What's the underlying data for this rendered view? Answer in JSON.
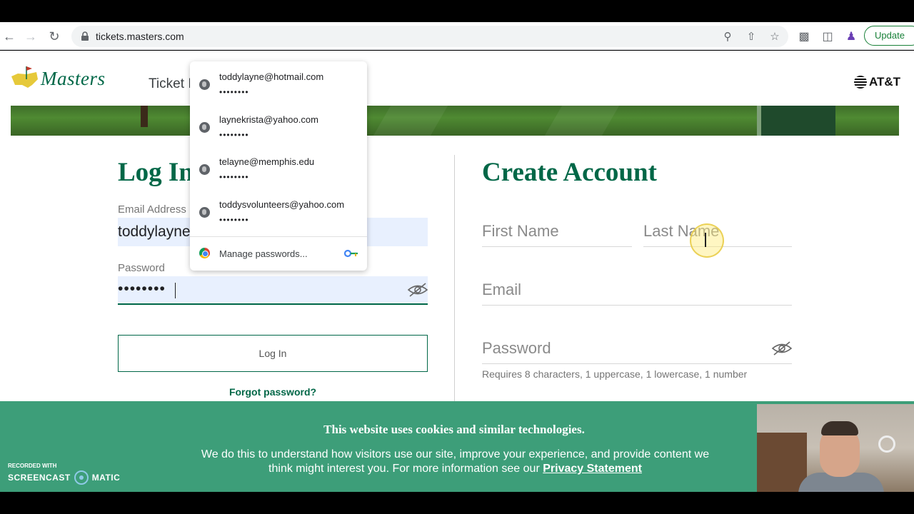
{
  "browser": {
    "url": "tickets.masters.com",
    "update_label": "Update"
  },
  "header": {
    "logo_text": "Masters",
    "nav_partial": "Ticket I",
    "sponsor": "AT&T"
  },
  "login": {
    "title": "Log In",
    "email_label": "Email Address",
    "email_value": "toddylayne",
    "password_label": "Password",
    "password_value": "••••••••",
    "button": "Log In",
    "forgot": "Forgot password?"
  },
  "autofill": {
    "items": [
      {
        "email": "toddylayne@hotmail.com",
        "masked": "••••••••"
      },
      {
        "email": "laynekrista@yahoo.com",
        "masked": "••••••••"
      },
      {
        "email": "telayne@memphis.edu",
        "masked": "••••••••"
      },
      {
        "email": "toddysvolunteers@yahoo.com",
        "masked": "••••••••"
      }
    ],
    "manage": "Manage passwords..."
  },
  "create_account": {
    "title": "Create Account",
    "first_name": "First Name",
    "last_name": "Last Name",
    "email": "Email",
    "password": "Password",
    "requirements": "Requires 8 characters, 1 uppercase, 1 lowercase, 1 number"
  },
  "cookie_banner": {
    "title": "This website uses cookies and similar technologies.",
    "body": "We do this to understand how visitors use our site, improve your experience, and provide content we think might interest you. For more information see our",
    "link": "Privacy Statement"
  },
  "watermark": {
    "recorded_with": "RECORDED WITH",
    "brand_left": "SCREENCAST",
    "brand_right": "MATIC"
  },
  "colors": {
    "brand_green": "#006747",
    "cookie_bg": "#3d9e79",
    "autofill_bg": "#e8f0fe"
  }
}
